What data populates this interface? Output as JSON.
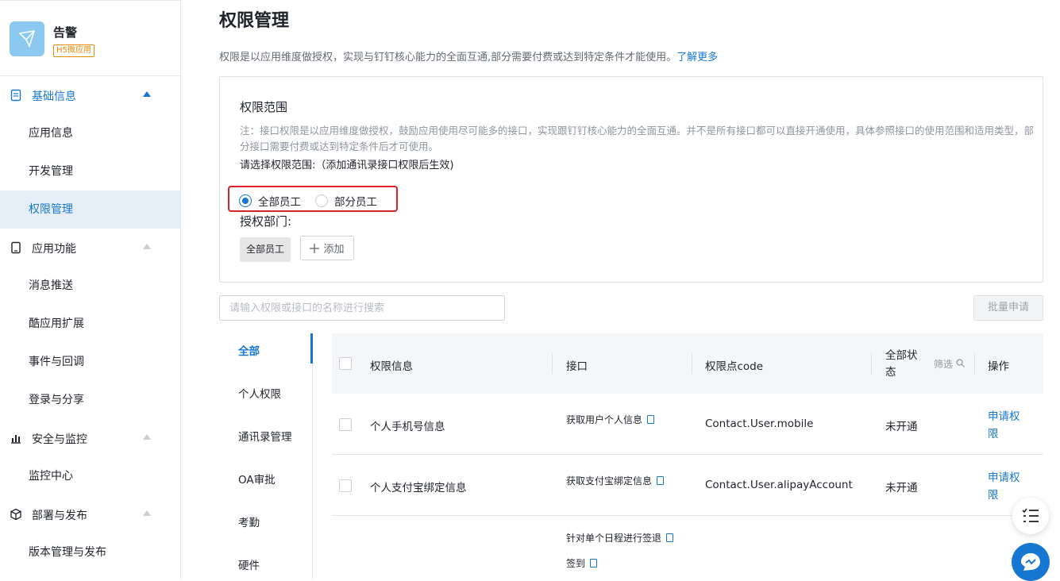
{
  "app": {
    "name": "告警",
    "badge": "H5微应用"
  },
  "sidebar": {
    "groups": [
      {
        "label": "基础信息",
        "icon": "document-icon",
        "items": [
          "应用信息",
          "开发管理",
          "权限管理"
        ]
      },
      {
        "label": "应用功能",
        "icon": "phone-icon",
        "items": [
          "消息推送",
          "酷应用扩展",
          "事件与回调",
          "登录与分享"
        ]
      },
      {
        "label": "安全与监控",
        "icon": "bar-chart-icon",
        "items": [
          "监控中心"
        ]
      },
      {
        "label": "部署与发布",
        "icon": "cube-icon",
        "items": [
          "版本管理与发布"
        ]
      }
    ],
    "active_item": "权限管理",
    "accent": "#1677d2"
  },
  "page": {
    "title": "权限管理",
    "desc": "权限是以应用维度做授权，实现与钉钉核心能力的全面互通,部分需要付费或达到特定条件才能使用。",
    "desc_link": "了解更多"
  },
  "scope": {
    "title": "权限范围",
    "note": "注：接口权限是以应用维度做授权，鼓励应用使用尽可能多的接口，实现跟钉钉核心能力的全面互通。并不是所有接口都可以直接开通使用，具体参照接口的使用范围和适用类型，部分接口需要付费或达到特定条件后才可使用。",
    "prompt": "请选择权限范围:（添加通讯录接口权限后生效)",
    "options": [
      "全部员工",
      "部分员工"
    ],
    "selected": "全部员工",
    "auth_dept_label": "授权部门:",
    "dept_tag": "全部员工",
    "add_label": "添加"
  },
  "search": {
    "placeholder": "请输入权限或接口的名称进行搜索"
  },
  "batch_button": "批量申请",
  "categories": [
    "全部",
    "个人权限",
    "通讯录管理",
    "OA审批",
    "考勤",
    "硬件"
  ],
  "table": {
    "headers": {
      "info": "权限信息",
      "api": "接口",
      "code": "权限点code",
      "status": "全部状态",
      "filter": "筛选",
      "action": "操作"
    },
    "rows": [
      {
        "info": "个人手机号信息",
        "api": "获取用户个人信息",
        "code": "Contact.User.mobile",
        "status": "未开通",
        "action": "申请权限"
      },
      {
        "info": "个人支付宝绑定信息",
        "api": "获取支付宝绑定信息",
        "code": "Contact.User.alipayAccount",
        "status": "未开通",
        "action": "申请权限"
      },
      {
        "api": "针对单个日程进行签退",
        "api2": "签到"
      }
    ]
  }
}
